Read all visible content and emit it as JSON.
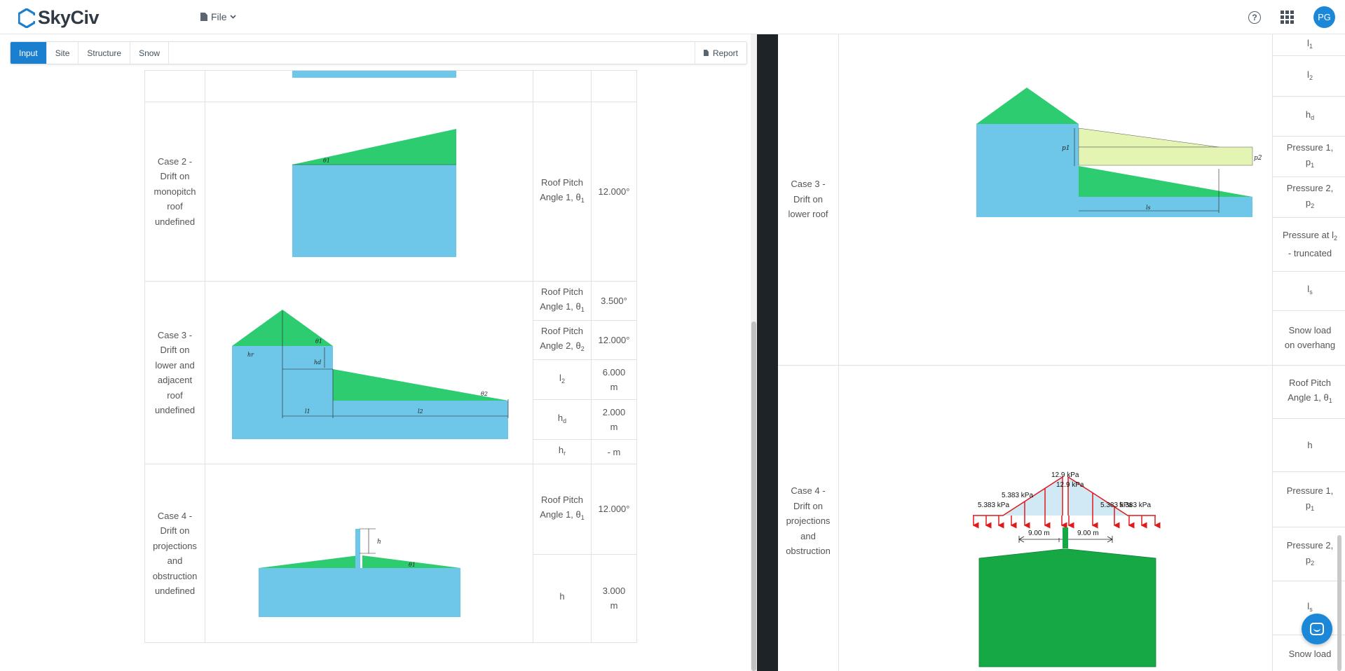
{
  "app": {
    "logo_text": "SkyCiv",
    "file_menu": "File",
    "avatar_initials": "PG",
    "help_glyph": "?"
  },
  "tabs": [
    {
      "label": "Input"
    },
    {
      "label": "Site"
    },
    {
      "label": "Structure"
    },
    {
      "label": "Snow"
    }
  ],
  "report_label": "Report",
  "left_table": {
    "case2": {
      "lines": [
        "Case 2 -",
        "Drift on",
        "monopitch",
        "roof",
        "",
        "undefined"
      ],
      "param_label": "Roof Pitch Angle 1, θ",
      "param_sub": "1",
      "value": "12.000°",
      "diagram_labels": {
        "theta": "θ1"
      }
    },
    "case3": {
      "lines": [
        "Case 3 -",
        "Drift on",
        "lower and",
        "adjacent",
        "roof",
        "",
        "undefined"
      ],
      "params": [
        {
          "label": "Roof Pitch Angle 1, θ",
          "sub": "1",
          "value": "3.500°"
        },
        {
          "label": "Roof Pitch Angle 2, θ",
          "sub": "2",
          "value": "12.000°"
        },
        {
          "label": "l",
          "sub": "2",
          "value": "6.000 m"
        },
        {
          "label": "h",
          "sub": "d",
          "value": "2.000 m"
        },
        {
          "label": "h",
          "sub": "r",
          "value": "- m"
        }
      ],
      "diagram_labels": {
        "theta1": "θ1",
        "theta2": "θ2",
        "hr": "hr",
        "hd": "hd",
        "l1": "l1",
        "l2": "l2"
      }
    },
    "case4": {
      "lines": [
        "Case 4 -",
        "Drift on",
        "projections",
        "and",
        "obstruction",
        "",
        "undefined"
      ],
      "params": [
        {
          "label": "Roof Pitch Angle 1, θ",
          "sub": "1",
          "value": "12.000°"
        },
        {
          "label": "h",
          "sub": "",
          "value": "3.000 m"
        }
      ],
      "diagram_labels": {
        "h": "h",
        "theta": "θ1"
      }
    }
  },
  "right_table": {
    "case3": {
      "lines": [
        "Case 3 -",
        "Drift on",
        "lower roof"
      ],
      "labels": [
        {
          "text": "l",
          "sub": "1"
        },
        {
          "text": "l",
          "sub": "2"
        },
        {
          "text": "h",
          "sub": "d"
        },
        {
          "text": "Pressure 1, p",
          "sub": "1"
        },
        {
          "text": "Pressure 2, p",
          "sub": "2"
        },
        {
          "text": "Pressure at l",
          "sub": "2",
          "tail": " - truncated"
        },
        {
          "text": "l",
          "sub": "s"
        },
        {
          "text": "Snow load on overhang",
          "sub": ""
        }
      ],
      "diagram_labels": {
        "p1": "p1",
        "p2": "p2",
        "ls": "ls"
      }
    },
    "case4": {
      "lines": [
        "Case 4 -",
        "Drift on",
        "projections",
        "and",
        "obstruction"
      ],
      "labels": [
        {
          "text": "Roof Pitch Angle 1, θ",
          "sub": "1"
        },
        {
          "text": "h",
          "sub": ""
        },
        {
          "text": "Pressure 1, p",
          "sub": "1"
        },
        {
          "text": "Pressure 2, p",
          "sub": "2"
        },
        {
          "text": "l",
          "sub": "s"
        },
        {
          "text": "Snow load",
          "sub": ""
        }
      ],
      "load_labels": {
        "peak_left": "12.9 kPa",
        "peak_right": "12.9 kPa",
        "mid_left": "5.383 kPa",
        "end_left": "5.383 kPa",
        "mid_right": "5.383 kPa",
        "end_right": "5.383 kPa",
        "dim_left": "9.00 m",
        "dim_right": "9.00 m"
      }
    }
  },
  "colors": {
    "accent": "#1b7fd0",
    "building_blue": "#6ec6e8",
    "snow_green": "#2ecc71",
    "drift_yellow": "#e4f5b3",
    "load_red": "#e0191b",
    "dark_green": "#16a844"
  },
  "icons": [
    "skyciv-logo-icon",
    "file-icon",
    "chevron-down-icon",
    "help-icon",
    "apps-grid-icon",
    "document-icon",
    "chat-icon"
  ]
}
